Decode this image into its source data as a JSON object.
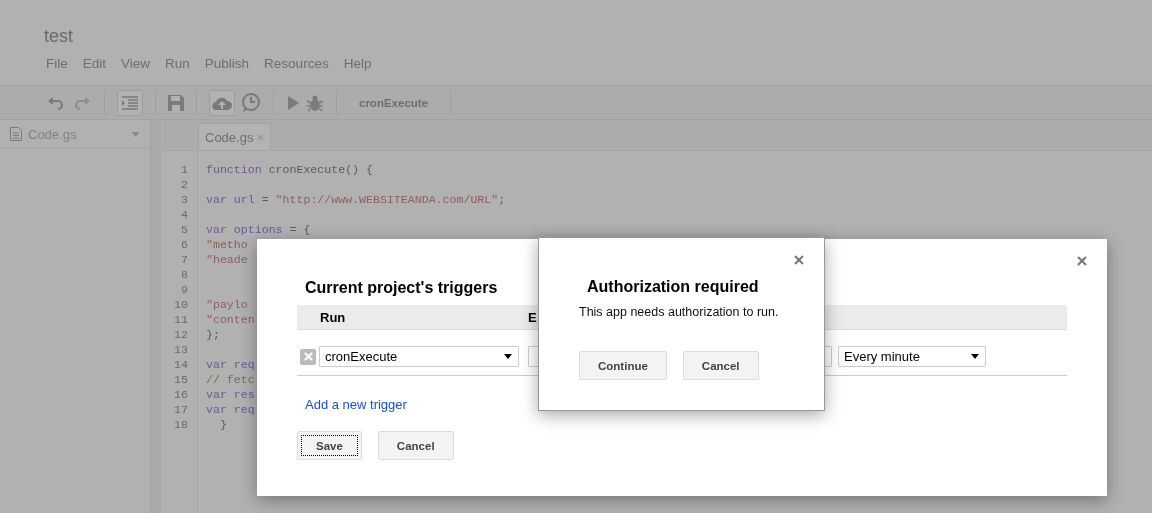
{
  "window": {
    "title": "test"
  },
  "menu": [
    "File",
    "Edit",
    "View",
    "Run",
    "Publish",
    "Resources",
    "Help"
  ],
  "toolbar": {
    "function_name": "cronExecute"
  },
  "sidebar": {
    "file": "Code.gs"
  },
  "editor": {
    "tab": "Code.gs",
    "lines": [
      {
        "number": "1",
        "tokens": [
          {
            "kind": "keyword",
            "text": "function"
          },
          {
            "kind": "plain",
            "text": " cronExecute() {"
          }
        ]
      },
      {
        "number": "2"
      },
      {
        "number": "3",
        "tokens": [
          {
            "kind": "keyword",
            "text": "var "
          },
          {
            "kind": "variable",
            "text": "url"
          },
          {
            "kind": "plain",
            "text": " = "
          },
          {
            "kind": "string",
            "text": "\"http://www.WEBSITEANDA.com/URL\""
          },
          {
            "kind": "plain",
            "text": ";"
          }
        ]
      },
      {
        "number": "4"
      },
      {
        "number": "5",
        "tokens": [
          {
            "kind": "keyword",
            "text": "var "
          },
          {
            "kind": "variable",
            "text": "options"
          },
          {
            "kind": "plain",
            "text": " = {"
          }
        ]
      },
      {
        "number": "6",
        "tokens": [
          {
            "kind": "string",
            "text": "\"metho"
          }
        ]
      },
      {
        "number": "7",
        "tokens": [
          {
            "kind": "string",
            "text": "\"heade"
          }
        ]
      },
      {
        "number": "8"
      },
      {
        "number": "9"
      },
      {
        "number": "10",
        "tokens": [
          {
            "kind": "string",
            "text": "\"paylo"
          }
        ]
      },
      {
        "number": "11",
        "tokens": [
          {
            "kind": "string",
            "text": "\"conten"
          }
        ]
      },
      {
        "number": "12",
        "tokens": [
          {
            "kind": "plain",
            "text": "};"
          }
        ]
      },
      {
        "number": "13"
      },
      {
        "number": "14",
        "tokens": [
          {
            "kind": "keyword",
            "text": "var "
          },
          {
            "kind": "variable",
            "text": "req"
          }
        ]
      },
      {
        "number": "15",
        "tokens": [
          {
            "kind": "comment",
            "text": "// fetc"
          }
        ]
      },
      {
        "number": "16",
        "tokens": [
          {
            "kind": "keyword",
            "text": "var "
          },
          {
            "kind": "variable",
            "text": "res"
          }
        ]
      },
      {
        "number": "17",
        "tokens": [
          {
            "kind": "keyword",
            "text": "var "
          },
          {
            "kind": "variable",
            "text": "req"
          }
        ]
      },
      {
        "number": "18",
        "tokens": [
          {
            "kind": "plain",
            "text": "  }"
          }
        ]
      }
    ]
  },
  "triggers_dialog": {
    "title": "Current project's triggers",
    "columns": [
      "Run",
      "E"
    ],
    "rows": [
      {
        "function": "cronExecute",
        "interval": "Every minute"
      }
    ],
    "add_link": "Add a new trigger",
    "buttons": [
      {
        "label": "Save",
        "focused": true
      },
      {
        "label": "Cancel",
        "focused": false
      }
    ]
  },
  "auth_dialog": {
    "title": "Authorization required",
    "message": "This app needs authorization to run.",
    "buttons": [
      "Continue",
      "Cancel"
    ]
  }
}
